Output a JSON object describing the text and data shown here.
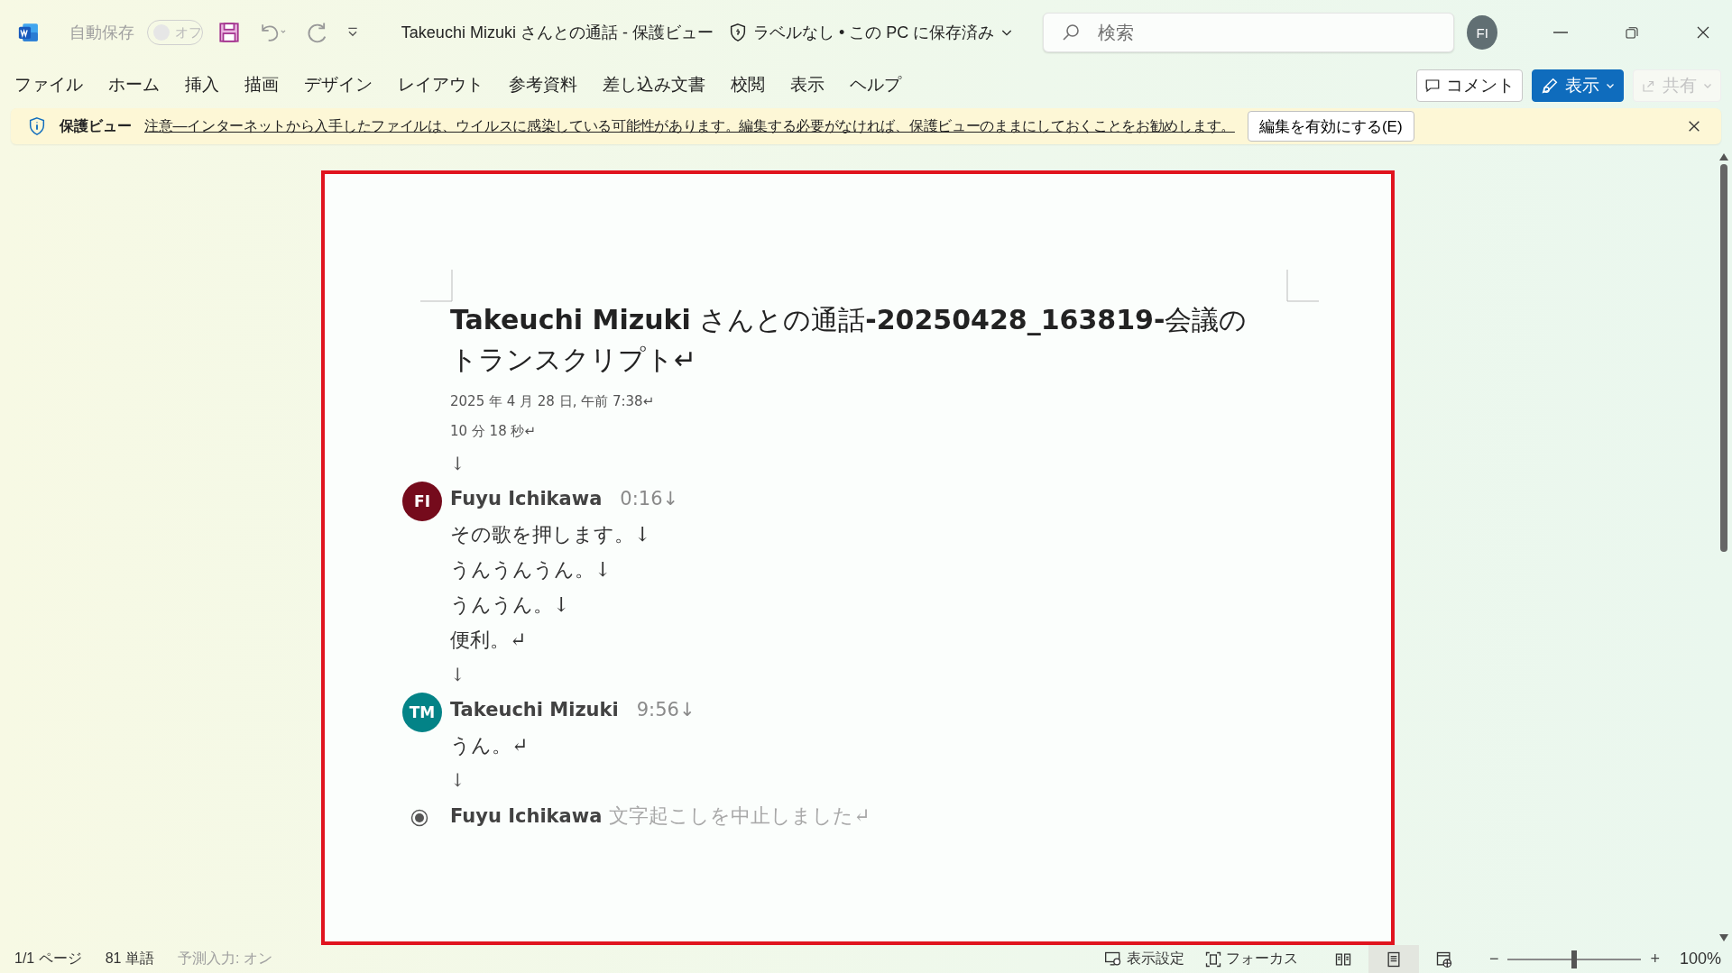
{
  "title_bar": {
    "autosave": {
      "label": "自動保存",
      "state": "オフ",
      "on": false
    },
    "document_title": "Takeuchi Mizuki さんとの通話  -  保護ビュー",
    "label_status": "ラベルなし • この PC に保存済み",
    "search": {
      "placeholder": "検索"
    },
    "avatar": "FI"
  },
  "ribbon": {
    "tabs": [
      {
        "label": "ファイル",
        "selected": false
      },
      {
        "label": "ホーム",
        "selected": false
      },
      {
        "label": "挿入",
        "selected": false
      },
      {
        "label": "描画",
        "selected": false
      },
      {
        "label": "デザイン",
        "selected": false
      },
      {
        "label": "レイアウト",
        "selected": false
      },
      {
        "label": "参考資料",
        "selected": false
      },
      {
        "label": "差し込み文書",
        "selected": false
      },
      {
        "label": "校閲",
        "selected": false
      },
      {
        "label": "表示",
        "selected": false
      },
      {
        "label": "ヘルプ",
        "selected": false
      }
    ],
    "buttons": [
      {
        "kind": "outline",
        "label": "コメント",
        "disabled": false
      },
      {
        "kind": "primary",
        "label": "表示",
        "disabled": false
      },
      {
        "kind": "share",
        "label": "共有",
        "disabled": true
      }
    ]
  },
  "message_bar": {
    "title": "保護ビュー",
    "message": "注意—インターネットから入手したファイルは、ウイルスに感染している可能性があります。編集する必要がなければ、保護ビューのままにしておくことをお勧めします。",
    "button": "編集を有効にする(E)"
  },
  "document": {
    "title": "**Takeuchi Mizuki** さんとの通話**-20250428_163819-**会議のトランスクリプト↵",
    "date": "2025 年 4 月 28 日, 午前 7:38↵",
    "duration": "10 分 18 秒↵",
    "spacer": "↓",
    "entries": [
      {
        "initials": "FI",
        "color": "#750b1c",
        "speaker": "Fuyu Ichikawa",
        "time": "0:16↓",
        "lines": [
          "その歌を押します。↓",
          "うんうんうん。↓",
          "うんうん。↓",
          "便利。↵"
        ],
        "after": "↓"
      },
      {
        "initials": "TM",
        "color": "#038387",
        "speaker": "Takeuchi Mizuki",
        "time": "9:56↓",
        "lines": [
          "うん。↵"
        ],
        "after": "↓"
      }
    ],
    "end": {
      "speaker": "Fuyu Ichikawa",
      "text": "文字起こしを中止しました↵"
    }
  },
  "status_bar": {
    "page": "1/1 ページ",
    "words": "81 単語",
    "prediction": "予測入力: オン",
    "display_settings": "表示設定",
    "focus": "フォーカス",
    "views": [
      {
        "kind": "read",
        "selected": false
      },
      {
        "kind": "print",
        "selected": true
      },
      {
        "kind": "web",
        "selected": false
      }
    ],
    "zoom_out": "−",
    "zoom_in": "+",
    "zoom": {
      "level": 0.5
    },
    "zoom_percent": "100%"
  }
}
